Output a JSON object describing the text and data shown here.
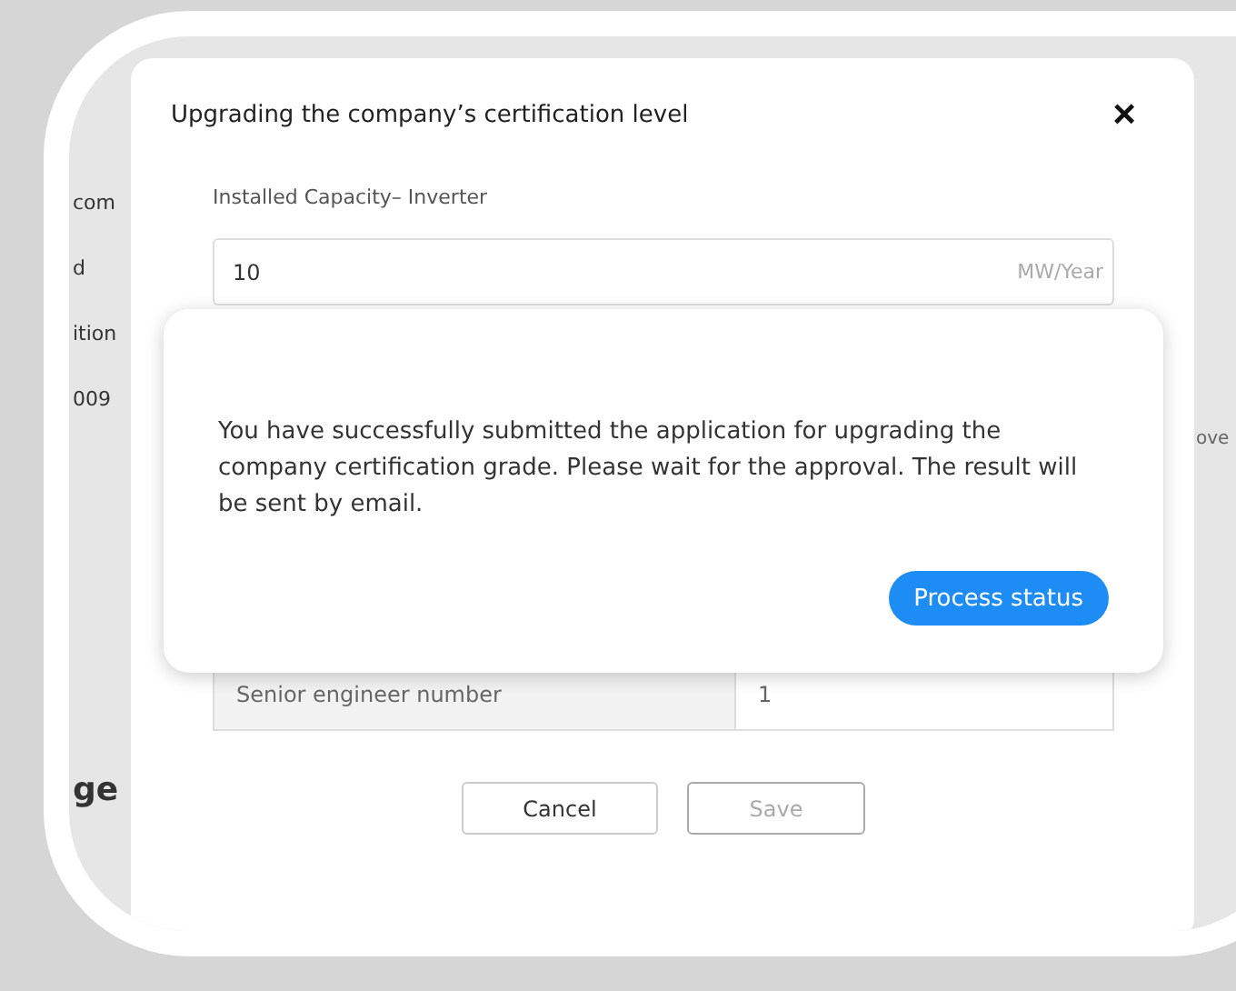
{
  "background_page": {
    "left_fragments": [
      "com",
      "d",
      "ition",
      "009"
    ],
    "left_heading": "ge",
    "right_fragment": "ove"
  },
  "dialog": {
    "title": "Upgrading the company’s certification level",
    "close": "×",
    "field_label": "Installed Capacity– Inverter",
    "field_value": "10",
    "field_unit": "MW/Year",
    "table_row": {
      "label": "Senior engineer number",
      "value": "1"
    },
    "buttons": [
      {
        "label": "Cancel",
        "disabled": false
      },
      {
        "label": "Save",
        "disabled": true
      }
    ]
  },
  "success_popup": {
    "message": "You have successfully submitted the application for upgrading the company certification grade. Please wait for the approval. The result will be sent by email.",
    "button": "Process status"
  }
}
